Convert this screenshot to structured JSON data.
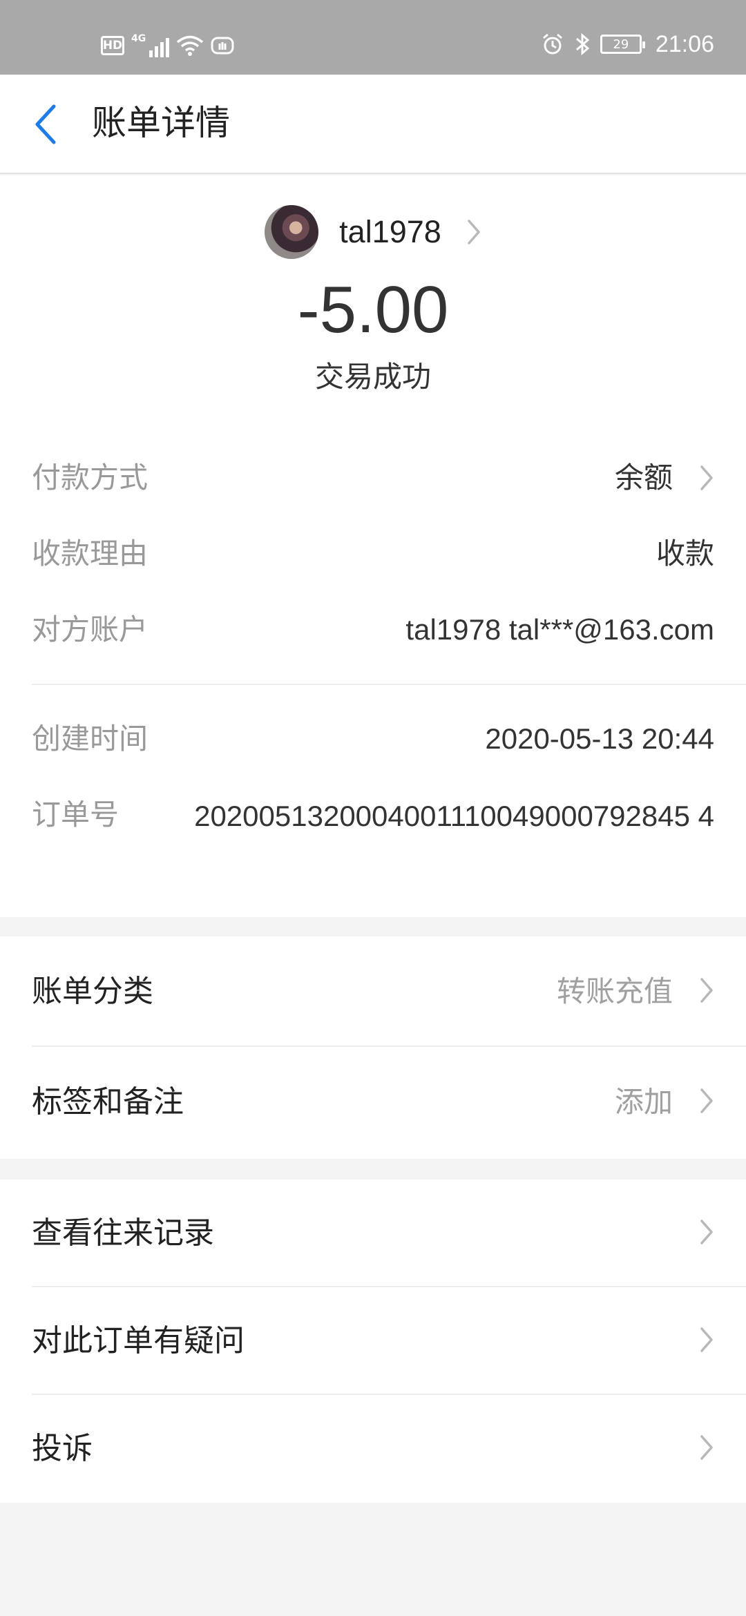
{
  "status_bar": {
    "hd": "HD",
    "network": "4G",
    "battery": "29",
    "time": "21:06",
    "icons": [
      "signal-icon",
      "wifi-icon",
      "shield-icon",
      "alarm-icon",
      "bluetooth-icon",
      "battery-icon"
    ]
  },
  "nav": {
    "title": "账单详情",
    "back_icon": "chevron-left-icon"
  },
  "header": {
    "payee_name": "tal1978",
    "amount": "-5.00",
    "status": "交易成功"
  },
  "details": {
    "payment_method": {
      "label": "付款方式",
      "value": "余额"
    },
    "reason": {
      "label": "收款理由",
      "value": "收款"
    },
    "counterparty": {
      "label": "对方账户",
      "value": "tal1978 tal***@163.com"
    },
    "created_time": {
      "label": "创建时间",
      "value": "2020-05-13 20:44"
    },
    "order_no": {
      "label": "订单号",
      "value": "2020051320004001110049000792845 4"
    }
  },
  "section_category": {
    "bill_category": {
      "label": "账单分类",
      "value": "转账充值"
    },
    "tags_notes": {
      "label": "标签和备注",
      "value": "添加"
    }
  },
  "section_actions": {
    "history": {
      "label": "查看往来记录"
    },
    "question": {
      "label": "对此订单有疑问"
    },
    "complain": {
      "label": "投诉"
    }
  },
  "colors": {
    "accent": "#1e7ce8",
    "status_bar": "#a9a9a9",
    "background": "#f4f4f4",
    "label_gray": "#999999",
    "text": "#333333"
  }
}
